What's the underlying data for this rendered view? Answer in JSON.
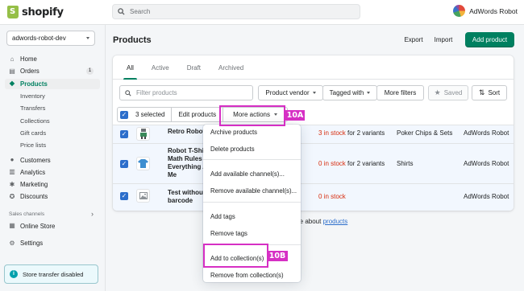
{
  "app": {
    "brand": "shopify",
    "store_name": "AdWords Robot",
    "store_selector": "adwords-robot-dev"
  },
  "search": {
    "placeholder": "Search"
  },
  "sidebar": {
    "items": [
      {
        "label": "Home",
        "icon": "home-icon"
      },
      {
        "label": "Orders",
        "icon": "orders-icon",
        "badge": "1"
      },
      {
        "label": "Products",
        "icon": "tag-icon",
        "active": true
      },
      {
        "label": "Inventory",
        "sub": true
      },
      {
        "label": "Transfers",
        "sub": true
      },
      {
        "label": "Collections",
        "sub": true
      },
      {
        "label": "Gift cards",
        "sub": true
      },
      {
        "label": "Price lists",
        "sub": true
      },
      {
        "label": "Customers",
        "icon": "customers-icon"
      },
      {
        "label": "Analytics",
        "icon": "analytics-icon"
      },
      {
        "label": "Marketing",
        "icon": "marketing-icon"
      },
      {
        "label": "Discounts",
        "icon": "discounts-icon"
      }
    ],
    "sales_channels_label": "Sales channels",
    "online_store": "Online Store",
    "settings": "Settings",
    "transfer_notice": "Store transfer disabled"
  },
  "header": {
    "title": "Products",
    "export": "Export",
    "import": "Import",
    "add_product": "Add product"
  },
  "tabs": [
    "All",
    "Active",
    "Draft",
    "Archived"
  ],
  "filters": {
    "placeholder": "Filter products",
    "product_vendor": "Product vendor",
    "tagged_with": "Tagged with",
    "more_filters": "More filters",
    "saved": "Saved",
    "sort": "Sort"
  },
  "bulk": {
    "selected": "3 selected",
    "edit": "Edit products",
    "more_actions": "More actions"
  },
  "products": [
    {
      "name": "Retro Robot",
      "stock_qty": "3 in stock",
      "stock_suffix": " for 2 variants",
      "type": "Poker Chips & Sets",
      "vendor": "AdWords Robot"
    },
    {
      "name": "Robot T-Shirt\nMath Rules\nEverything A\nMe",
      "stock_qty": "0 in stock",
      "stock_suffix": " for 2 variants",
      "type": "Shirts",
      "vendor": "AdWords Robot"
    },
    {
      "name": "Test without\nbarcode",
      "stock_qty": "0 in stock",
      "stock_suffix": "",
      "type": "",
      "vendor": "AdWords Robot"
    }
  ],
  "learn_more": {
    "prefix": "re about ",
    "link": "products"
  },
  "dropdown": {
    "items": [
      "Archive products",
      "Delete products",
      "Add available channel(s)...",
      "Remove available channel(s)...",
      "Add tags",
      "Remove tags",
      "Add to collection(s)",
      "Remove from collection(s)"
    ]
  },
  "annotations": {
    "a": "10A",
    "b": "10B",
    "color": "#d62fc4"
  },
  "colors": {
    "primary": "#008060",
    "selection": "#2c6ecb",
    "critical": "#d72c0d"
  }
}
